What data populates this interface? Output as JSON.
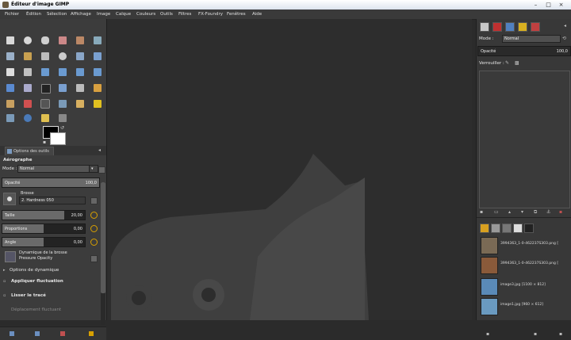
{
  "window": {
    "title": "Éditeur d'image GIMP"
  },
  "menu": [
    "Fichier",
    "Édition",
    "Sélection",
    "Affichage",
    "Image",
    "Calque",
    "Couleurs",
    "Outils",
    "Filtres",
    "FX-Foundry",
    "Fenêtres",
    "Aide"
  ],
  "toolbox": {
    "tab_label": "Options des outils",
    "tool_name": "Aérographe",
    "mode_label": "Mode :",
    "mode_value": "Normal",
    "opacity_label": "Opacité",
    "opacity_value": "100,0",
    "brush_label": "Brosse",
    "brush_value": "2. Hardness 050",
    "sliders": [
      {
        "name": "Taille",
        "value": "20,00",
        "fill": 0.75
      },
      {
        "name": "Proportions",
        "value": "0,00",
        "fill": 0.4
      },
      {
        "name": "Angle",
        "value": "0,00",
        "fill": 0.45
      }
    ],
    "dynamics_line1": "Dynamique de la brosse",
    "dynamics_line2": "Pressure Opacity",
    "dynamics_options": "Options de dynamique",
    "apply_jitter": "Appliquer fluctuation",
    "smooth_stroke": "Lisser le tracé",
    "incremental": "Déplacement fluctuant"
  },
  "layers": {
    "mode_label": "Mode :",
    "mode_value": "Normal",
    "opacity_label": "Opacité",
    "opacity_value": "100,0",
    "lock_label": "Verrouiller :"
  },
  "images": [
    {
      "name": "3994363_1-0-462237S303.png [",
      "color": "#7a6a55"
    },
    {
      "name": "3994363_1-0-462237S303.png [",
      "color": "#8a5a3a"
    },
    {
      "name": "image3.jpg [1100 × 812]",
      "color": "#5a8ab8"
    },
    {
      "name": "image1.jpg [960 × 612]",
      "color": "#6a9ac0"
    }
  ],
  "colors": {
    "accent": "#d8a000",
    "panel": "#3c3c3c",
    "canvas": "#2d2d2d"
  }
}
